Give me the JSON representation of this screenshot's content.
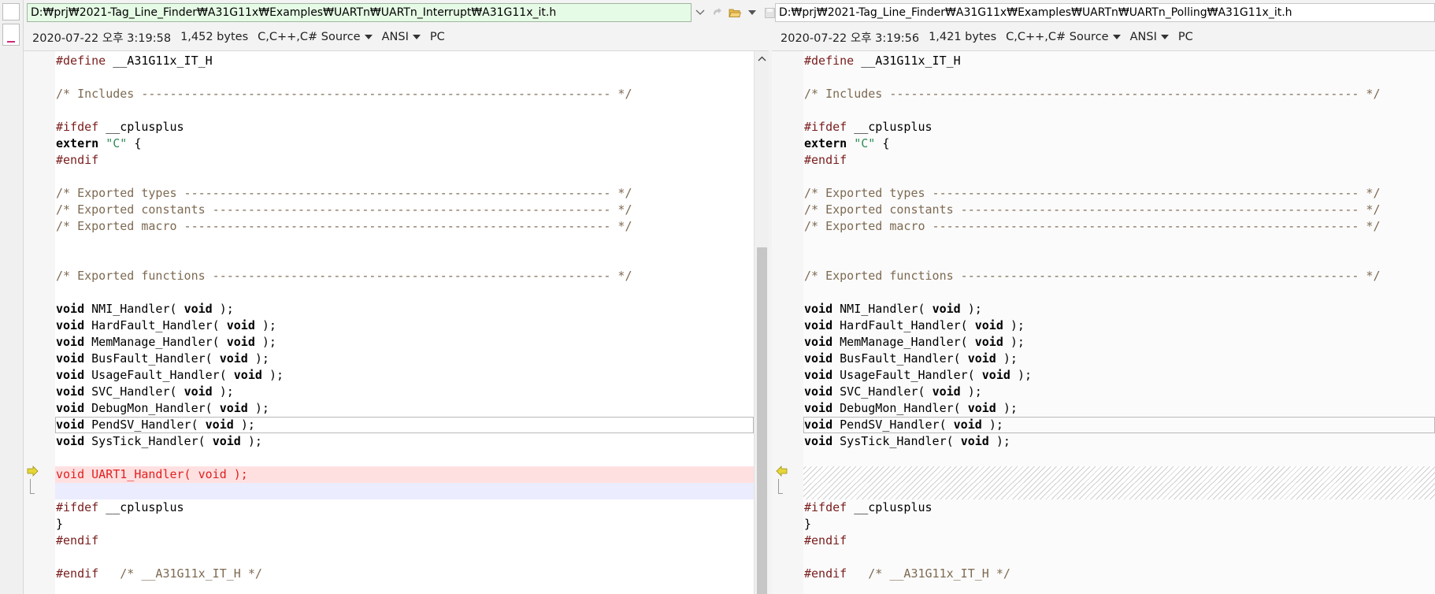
{
  "left": {
    "path": "D:₩prj₩2021-Tag_Line_Finder₩A31G11x₩Examples₩UARTn₩UARTn_Interrupt₩A31G11x_it.h",
    "timestamp": "2020-07-22 오후 3:19:58",
    "size": "1,452 bytes",
    "syntax": "C,C++,C# Source",
    "encoding": "ANSI",
    "eol": "PC"
  },
  "right": {
    "path": "D:₩prj₩2021-Tag_Line_Finder₩A31G11x₩Examples₩UARTn₩UARTn_Polling₩A31G11x_it.h",
    "timestamp": "2020-07-22 오후 3:19:56",
    "size": "1,421 bytes",
    "syntax": "C,C++,C# Source",
    "encoding": "ANSI",
    "eol": "PC"
  },
  "icons": {
    "dropdown": "chevron-down-icon",
    "next_diff": "next-diff-icon",
    "open_folder": "folder-open-icon",
    "save": "save-icon",
    "marker": "arrow-marker-icon",
    "scroll_up": "scroll-up-icon"
  },
  "colors": {
    "deleted_line_bg": "#ffe0e0",
    "deleted_line_text": "#e02020",
    "pad_line_bg": "#ececff",
    "active_path_bg": "#e6fbe6",
    "marker": "#d8c62a"
  },
  "code": {
    "define": [
      "#define",
      "__A31G11x_IT_H"
    ],
    "includes_comment": "/* Includes ------------------------------------------------------------------ */",
    "ifdef1": [
      "#ifdef",
      "__cplusplus"
    ],
    "extern": [
      "extern",
      "\"C\"",
      "{"
    ],
    "endif1": "#endif",
    "types_comment": "/* Exported types ------------------------------------------------------------ */",
    "constants_comment": "/* Exported constants -------------------------------------------------------- */",
    "macro_comment": "/* Exported macro ------------------------------------------------------------ */",
    "functions_comment": "/* Exported functions -------------------------------------------------------- */",
    "void": "void",
    "handlers": [
      {
        "name": "NMI_Handler(",
        "arg": "void",
        "end": ");"
      },
      {
        "name": "HardFault_Handler(",
        "arg": "void",
        "end": ");"
      },
      {
        "name": "MemManage_Handler(",
        "arg": "void",
        "end": ");"
      },
      {
        "name": "BusFault_Handler(",
        "arg": "void",
        "end": ");"
      },
      {
        "name": "UsageFault_Handler(",
        "arg": "void",
        "end": ");"
      },
      {
        "name": "SVC_Handler(",
        "arg": "void",
        "end": ");"
      },
      {
        "name": "DebugMon_Handler(",
        "arg": "void",
        "end": ");"
      },
      {
        "name": "PendSV_Handler(",
        "arg": "void",
        "end": ");"
      },
      {
        "name": "SysTick_Handler(",
        "arg": "void",
        "end": ");"
      }
    ],
    "uart_line": "void UART1_Handler( void );",
    "ifdef2": [
      "#ifdef",
      "__cplusplus"
    ],
    "close_brace": "}",
    "endif2": "#endif",
    "endif_final": [
      "#endif",
      "/* __A31G11x_IT_H */"
    ]
  }
}
